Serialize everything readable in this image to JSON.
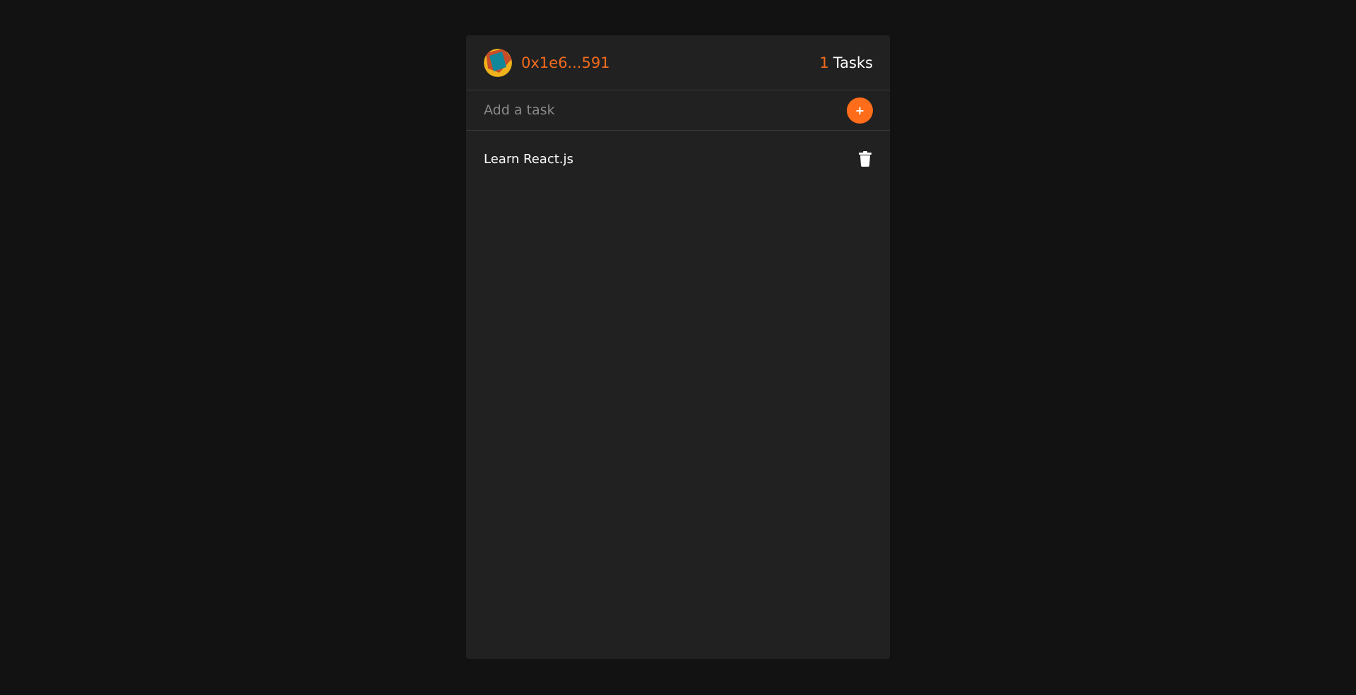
{
  "account": {
    "address": "0x1e6...591",
    "avatar_icon": "identicon-avatar"
  },
  "tasks_count": {
    "number": "1",
    "label": "Tasks"
  },
  "add_task": {
    "placeholder": "Add a task",
    "button_label": "+"
  },
  "tasks": [
    {
      "text": "Learn React.js",
      "icon": "trash-icon"
    }
  ],
  "colors": {
    "accent": "#ff6d1a",
    "background": "#121212",
    "card": "#212121"
  }
}
